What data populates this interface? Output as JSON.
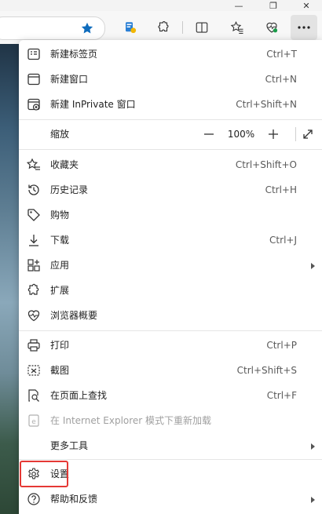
{
  "window": {
    "minimize_glyph": "—",
    "restore_glyph": "❐",
    "close_glyph": "✕"
  },
  "toolbar": {
    "icons": [
      "favorite-star-icon",
      "extension-badge-icon",
      "extensions-puzzle-icon",
      "split-screen-icon",
      "favorites-icon",
      "browser-essentials-icon",
      "more-options-icon"
    ]
  },
  "menu": {
    "items": [
      {
        "label": "新建标签页",
        "shortcut": "Ctrl+T"
      },
      {
        "label": "新建窗口",
        "shortcut": "Ctrl+N"
      },
      {
        "label": "新建 InPrivate 窗口",
        "shortcut": "Ctrl+Shift+N"
      },
      {
        "label": "收藏夹",
        "shortcut": "Ctrl+Shift+O"
      },
      {
        "label": "历史记录",
        "shortcut": "Ctrl+H"
      },
      {
        "label": "购物",
        "shortcut": ""
      },
      {
        "label": "下载",
        "shortcut": "Ctrl+J"
      },
      {
        "label": "应用",
        "shortcut": ""
      },
      {
        "label": "扩展",
        "shortcut": ""
      },
      {
        "label": "浏览器概要",
        "shortcut": ""
      },
      {
        "label": "打印",
        "shortcut": "Ctrl+P"
      },
      {
        "label": "截图",
        "shortcut": "Ctrl+Shift+S"
      },
      {
        "label": "在页面上查找",
        "shortcut": "Ctrl+F"
      },
      {
        "label": "在 Internet Explorer 模式下重新加载",
        "shortcut": ""
      },
      {
        "label": "更多工具",
        "shortcut": ""
      },
      {
        "label": "设置",
        "shortcut": ""
      },
      {
        "label": "帮助和反馈",
        "shortcut": ""
      }
    ],
    "zoom": {
      "label": "缩放",
      "value": "100%",
      "minus": "—",
      "plus": "+"
    }
  },
  "colors": {
    "highlight": "#e53935",
    "accent": "#0f6cbd"
  }
}
